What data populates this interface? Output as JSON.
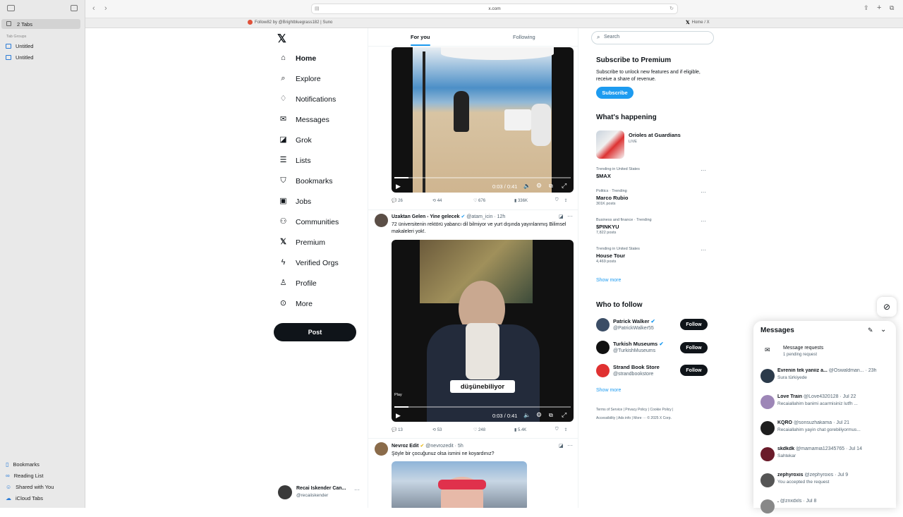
{
  "browser": {
    "tabs_count_label": "2 Tabs",
    "tab_groups_label": "Tab Groups",
    "tab_groups": [
      "Untitled",
      "Untitled"
    ],
    "address": "x.com",
    "tab1": "Follow82 by @Brightbluegrass182 | Suno",
    "tab2": "Home / X",
    "bottom_links": [
      "Bookmarks",
      "Reading List",
      "Shared with You",
      "iCloud Tabs"
    ]
  },
  "nav": {
    "items": [
      "Home",
      "Explore",
      "Notifications",
      "Messages",
      "Grok",
      "Lists",
      "Bookmarks",
      "Jobs",
      "Communities",
      "Premium",
      "Verified Orgs",
      "Profile",
      "More"
    ],
    "post_label": "Post",
    "account_name": "Recai Iskender Can...",
    "account_handle": "@recaiiskender"
  },
  "feed": {
    "tab_for_you": "For you",
    "tab_following": "Following",
    "tweet1": {
      "time": "0:03 / 0:41",
      "replies": "26",
      "reposts": "44",
      "likes": "676",
      "views": "336K"
    },
    "tweet2": {
      "name": "Uzaktan Gelen - Yine gelecek",
      "handle": "@atam_icin",
      "age": "· 12h",
      "text": "72 üniversitenin rektörü yabancı dil bilmiyor ve yurt dışında yayınlanmış Bilimsel makaleleri yok!.",
      "caption": "düşünebiliyor",
      "play_hint": "Play",
      "time": "0:03 / 0:41",
      "replies": "13",
      "reposts": "53",
      "likes": "248",
      "views": "5.4K"
    },
    "tweet3": {
      "name": "Nevroz Edit",
      "handle": "@nevrozedit",
      "age": "· 5h",
      "text": "Şöyle bir çocuğunuz olsa ismini ne koyardınız?"
    }
  },
  "right": {
    "search_placeholder": "Search",
    "premium": {
      "title": "Subscribe to Premium",
      "body": "Subscribe to unlock new features and if eligible, receive a share of revenue.",
      "button": "Subscribe"
    },
    "happening": {
      "title": "What's happening",
      "event_title": "Orioles at Guardians",
      "event_sub": "LIVE",
      "trends": [
        {
          "meta": "Trending in United States",
          "title": "$MAX",
          "sub": ""
        },
        {
          "meta": "Politics · Trending",
          "title": "Marco Rubio",
          "sub": "301K posts"
        },
        {
          "meta": "Business and finance · Trending",
          "title": "$PINKYU",
          "sub": "7,822 posts"
        },
        {
          "meta": "Trending in United States",
          "title": "House Tour",
          "sub": "4,469 posts"
        }
      ],
      "show_more": "Show more"
    },
    "who_to_follow": {
      "title": "Who to follow",
      "accounts": [
        {
          "name": "Patrick Walker",
          "handle": "@PatrickWalker55",
          "button": "Follow"
        },
        {
          "name": "Turkish Museums",
          "handle": "@TurkishMuseums",
          "button": "Follow"
        },
        {
          "name": "Strand Book Store",
          "handle": "@strandbookstore",
          "button": "Follow"
        }
      ],
      "show_more": "Show more"
    },
    "footer_line1": "Terms of Service  |  Privacy Policy  |  Cookie Policy  |",
    "footer_line2": "Accessibility  |  Ads info  |  More ···  © 2025 X Corp."
  },
  "messages": {
    "title": "Messages",
    "requests_title": "Message requests",
    "requests_sub": "1 pending request",
    "conversations": [
      {
        "name": "Evrenin tek yaniiz a...",
        "handle": "@Oswaldman...",
        "age": "· 23h",
        "preview": "Sura türkiyede",
        "color": "#2b3a4a"
      },
      {
        "name": "Love Train",
        "handle": "@Love4320128",
        "age": "· Jul 22",
        "preview": "Recaiallahim banimi acarmisiniz lutfh ...",
        "color": "#9d86b7"
      },
      {
        "name": "KQRO",
        "handle": "@sonsuzhakama",
        "age": "· Jul 21",
        "preview": "Recaiallahim yayin chat gorebiliyormus...",
        "color": "#1e1e1e"
      },
      {
        "name": "skdkdk",
        "handle": "@mamamia12345765",
        "age": "· Jul 14",
        "preview": "Sahtekar",
        "color": "#6a1b2a"
      },
      {
        "name": "zephyroxis",
        "handle": "@zephyroxis",
        "age": "· Jul 9",
        "preview": "You accepted the request",
        "color": "#555"
      },
      {
        "name": ".",
        "handle": "@znxdxls",
        "age": "· Jul 8",
        "preview": "",
        "color": "#888"
      }
    ]
  }
}
